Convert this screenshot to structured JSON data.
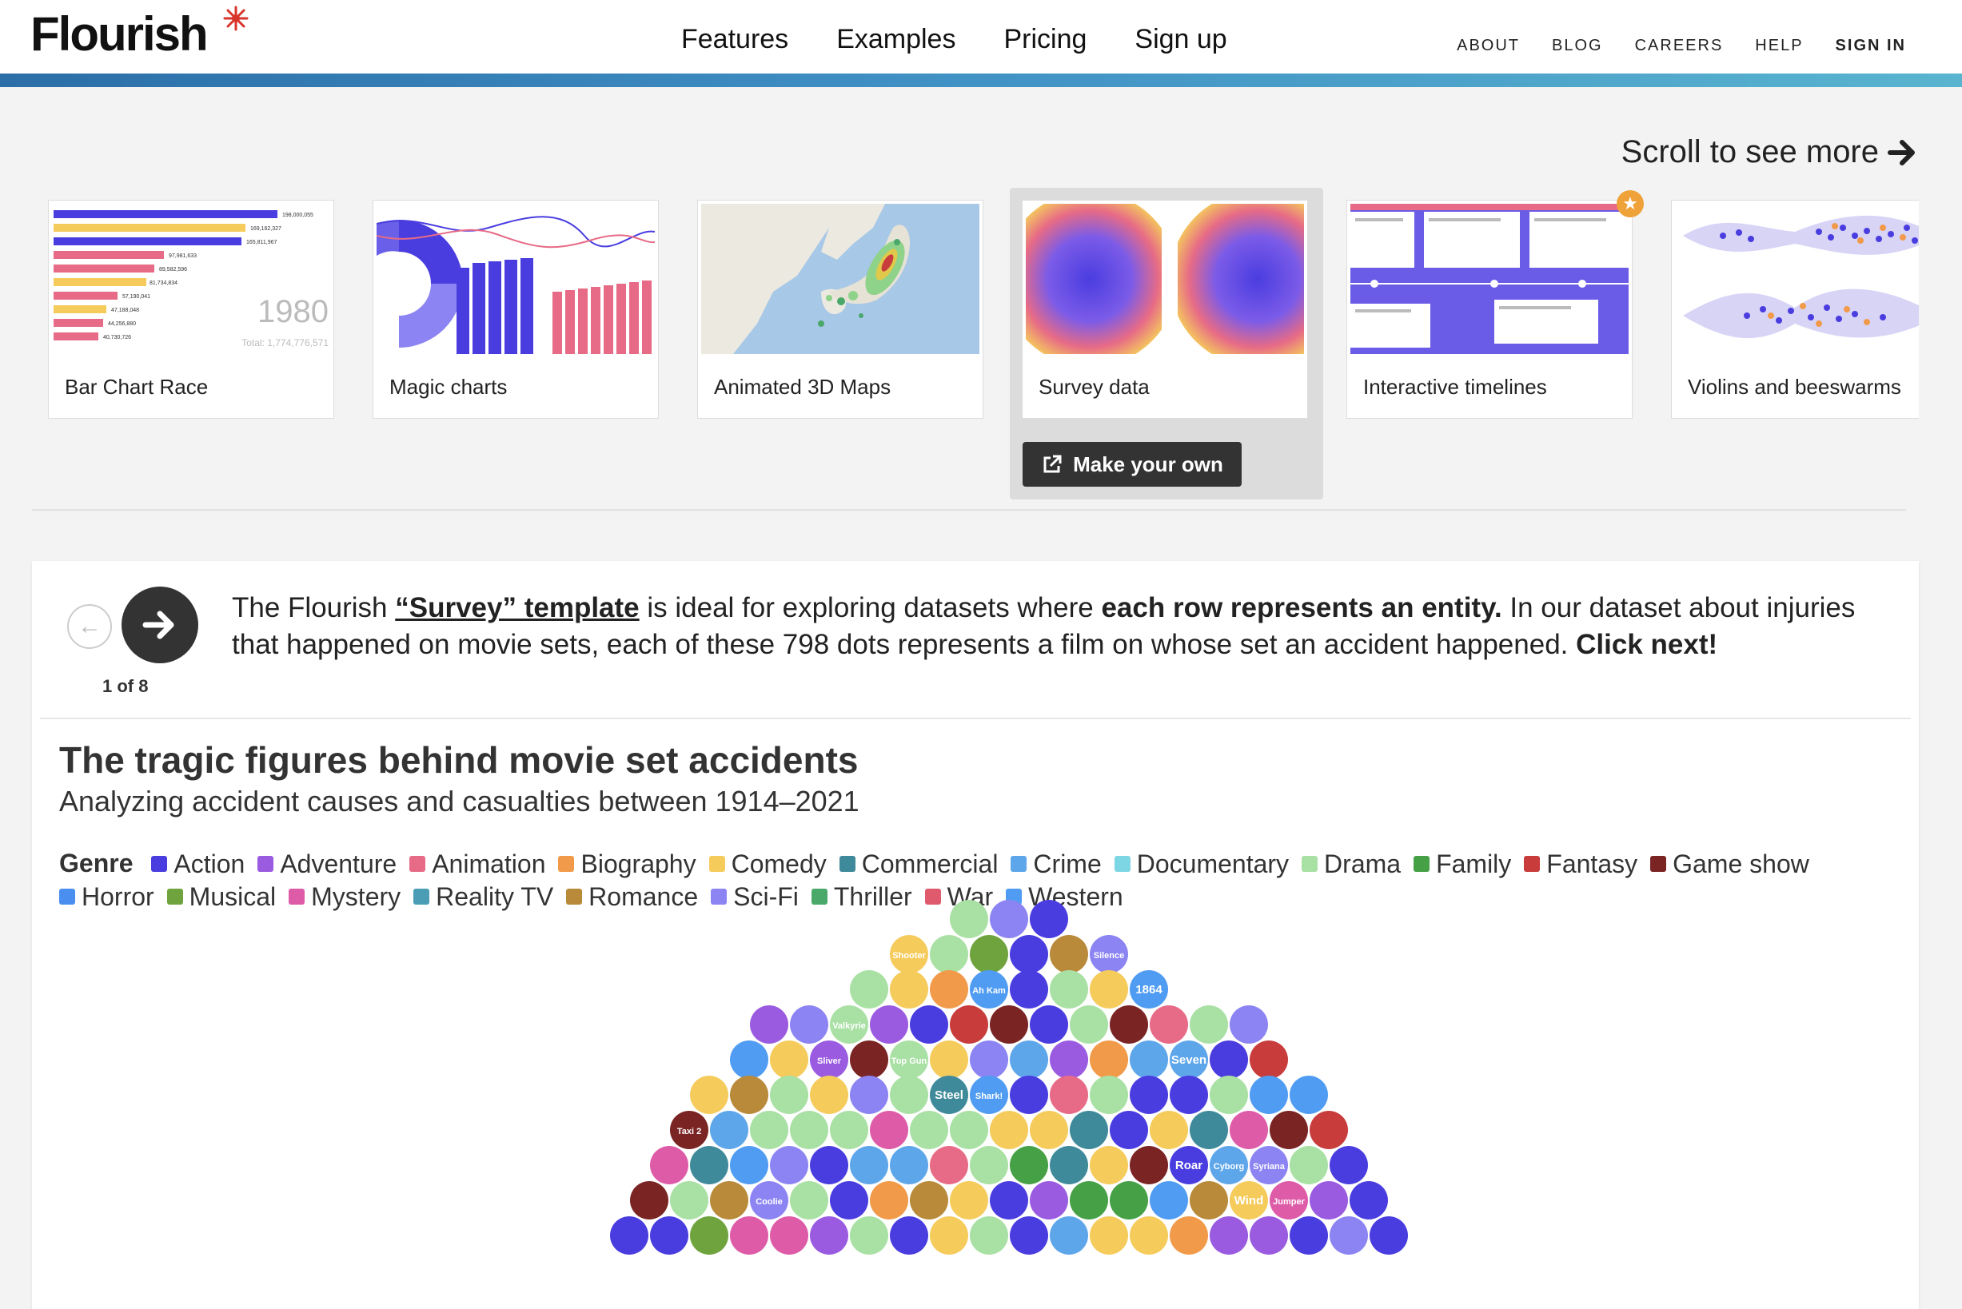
{
  "brand": {
    "name": "Flourish"
  },
  "nav": {
    "main": [
      "Features",
      "Examples",
      "Pricing",
      "Sign up"
    ],
    "secondary": [
      "ABOUT",
      "BLOG",
      "CAREERS",
      "HELP",
      "SIGN IN"
    ]
  },
  "scroll_hint": "Scroll to see more",
  "templates": [
    {
      "label": "Bar Chart Race",
      "year": "1980",
      "total": "Total: 1,774,776,571",
      "values": [
        "198,000,055",
        "169,162,327",
        "165,811,967",
        "97,981,633",
        "89,582,596",
        "81,734,834",
        "57,190,041",
        "47,188,048",
        "44,256,880",
        "40,730,726"
      ]
    },
    {
      "label": "Magic charts"
    },
    {
      "label": "Animated 3D Maps"
    },
    {
      "label": "Survey data"
    },
    {
      "label": "Interactive timelines"
    },
    {
      "label": "Violins and beeswarms"
    }
  ],
  "make_button": "Make your own",
  "story": {
    "step": "1 of 8",
    "caption": {
      "p1": "The Flourish ",
      "link": "“Survey” template",
      "p2": " is ideal for exploring datasets where ",
      "b1": "each row represents an entity.",
      "p3": " In our dataset about injuries that happened on movie sets, each of these 798 dots represents a film on whose set an accident happened. ",
      "b2": "Click next!"
    }
  },
  "chart": {
    "title": "The tragic figures behind movie set accidents",
    "subtitle": "Analyzing accident causes and casualties between 1914–2021",
    "legend_title": "Genre",
    "genres": [
      {
        "name": "Action",
        "color": "#4a3de0"
      },
      {
        "name": "Adventure",
        "color": "#9a5be0"
      },
      {
        "name": "Animation",
        "color": "#e76b86"
      },
      {
        "name": "Biography",
        "color": "#f19a4a"
      },
      {
        "name": "Comedy",
        "color": "#f5cb5c"
      },
      {
        "name": "Commercial",
        "color": "#3f8a9a"
      },
      {
        "name": "Crime",
        "color": "#5ea6ea"
      },
      {
        "name": "Documentary",
        "color": "#7dd6e3"
      },
      {
        "name": "Drama",
        "color": "#a9e0a4"
      },
      {
        "name": "Family",
        "color": "#46a146"
      },
      {
        "name": "Fantasy",
        "color": "#c83c3c"
      },
      {
        "name": "Game show",
        "color": "#7b2424"
      },
      {
        "name": "Horror",
        "color": "#4a8ff0"
      },
      {
        "name": "Musical",
        "color": "#6fa33e"
      },
      {
        "name": "Mystery",
        "color": "#de5ba8"
      },
      {
        "name": "Reality TV",
        "color": "#4a9db5"
      },
      {
        "name": "Romance",
        "color": "#b88a3a"
      },
      {
        "name": "Sci-Fi",
        "color": "#8b84f2"
      },
      {
        "name": "Thriller",
        "color": "#4aa86a"
      },
      {
        "name": "War",
        "color": "#e05a6e"
      },
      {
        "name": "Western",
        "color": "#4f9cf2"
      }
    ],
    "dot_labels": [
      "Shooter",
      "Silence",
      "Ah Kam",
      "1864",
      "Valkyrie",
      "Sliver",
      "Top Gun",
      "Seven",
      "Steel",
      "Shark!",
      "Taxi 2",
      "Roar",
      "Cyborg",
      "Syriana",
      "Coolie",
      "Wind",
      "Jumper"
    ]
  }
}
